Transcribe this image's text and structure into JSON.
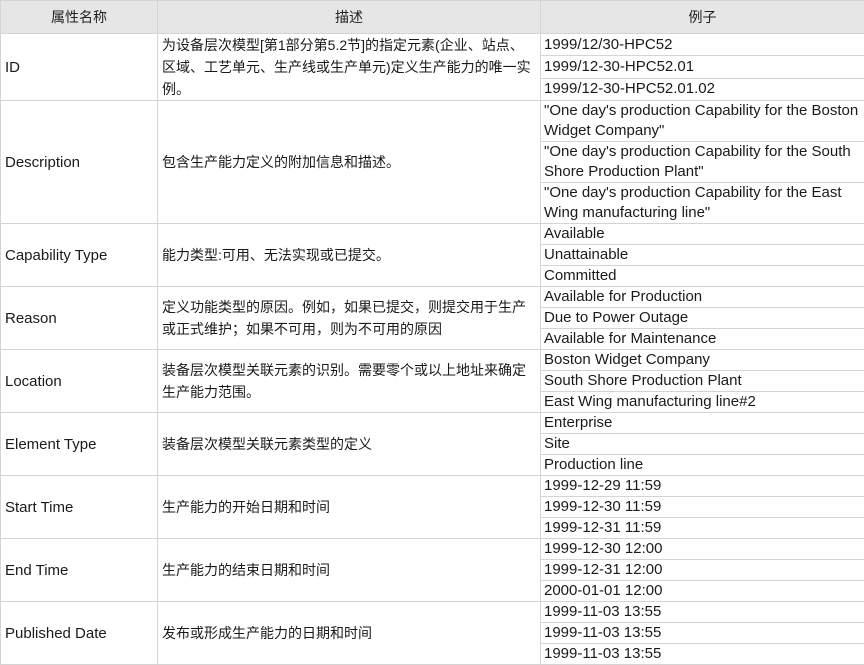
{
  "header": {
    "name": "属性名称",
    "desc": "描述",
    "example": "例子"
  },
  "rows": [
    {
      "name": "ID",
      "desc": "为设备层次模型[第1部分第5.2节]的指定元素(企业、站点、区域、工艺单元、生产线或生产单元)定义生产能力的唯一实例。",
      "examples": [
        "1999/12/30-HPC52",
        "1999/12-30-HPC52.01",
        "1999/12-30-HPC52.01.02"
      ]
    },
    {
      "name": "Description",
      "desc": "包含生产能力定义的附加信息和描述。",
      "examples": [
        "\"One day's production Capability for the Boston Widget Company\"",
        "\"One day's production Capability for the South Shore Production Plant\"",
        "\"One day's production Capability for the East Wing manufacturing line\""
      ]
    },
    {
      "name": "Capability Type",
      "desc": "能力类型:可用、无法实现或已提交。",
      "examples": [
        "Available",
        "Unattainable",
        "Committed"
      ]
    },
    {
      "name": "Reason",
      "desc": "定义功能类型的原因。例如，如果已提交，则提交用于生产或正式维护；如果不可用，则为不可用的原因",
      "examples": [
        "Available for Production",
        "Due to Power Outage",
        "Available for Maintenance"
      ]
    },
    {
      "name": "Location",
      "desc": "装备层次模型关联元素的识别。需要零个或以上地址来确定生产能力范围。",
      "examples": [
        "Boston Widget Company",
        "South Shore Production Plant",
        "East Wing manufacturing line#2"
      ]
    },
    {
      "name": "Element Type",
      "desc": "装备层次模型关联元素类型的定义",
      "examples": [
        "Enterprise",
        "Site",
        "Production line"
      ]
    },
    {
      "name": "Start Time",
      "desc": "生产能力的开始日期和时间",
      "examples": [
        "1999-12-29 11:59",
        "1999-12-30 11:59",
        "1999-12-31 11:59"
      ]
    },
    {
      "name": "End Time",
      "desc": "生产能力的结束日期和时间",
      "examples": [
        "1999-12-30 12:00",
        "1999-12-31 12:00",
        "2000-01-01 12:00"
      ]
    },
    {
      "name": "Published Date",
      "desc": "发布或形成生产能力的日期和时间",
      "examples": [
        "1999-11-03 13:55",
        "1999-11-03 13:55",
        "1999-11-03 13:55"
      ]
    }
  ]
}
